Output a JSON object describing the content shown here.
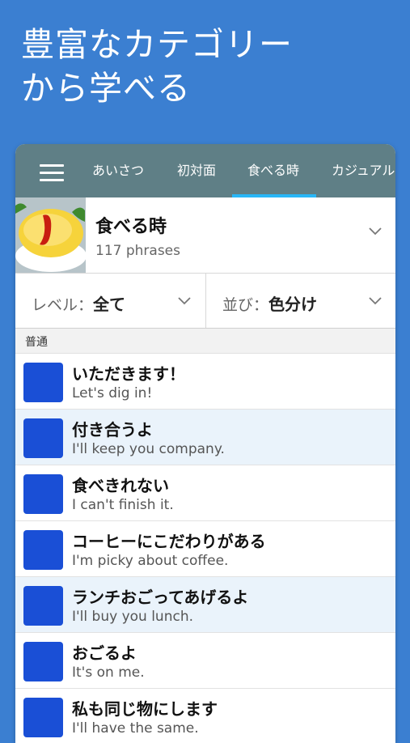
{
  "headline": {
    "line1": "豊富なカテゴリー",
    "line2": "から学べる"
  },
  "tabs": [
    "あいさつ",
    "初対面",
    "食べる時",
    "カジュアル"
  ],
  "category": {
    "title": "食べる時",
    "count": "117 phrases"
  },
  "filters": {
    "level": {
      "label": "レベル：",
      "value": "全て"
    },
    "sort": {
      "label": "並び：",
      "value": "色分け"
    }
  },
  "section": "普通",
  "phrases": [
    {
      "ja": "いただきます！",
      "en": "Let's dig in!"
    },
    {
      "ja": "付き合うよ",
      "en": "I'll keep you company."
    },
    {
      "ja": "食べきれない",
      "en": "I can't finish it."
    },
    {
      "ja": "コーヒーにこだわりがある",
      "en": "I'm picky about coffee."
    },
    {
      "ja": "ランチおごってあげるよ",
      "en": "I'll buy you lunch."
    },
    {
      "ja": "おごるよ",
      "en": "It's on me."
    },
    {
      "ja": "私も同じ物にします",
      "en": "I'll have the same."
    }
  ],
  "colors": {
    "background": "#3b7fd1",
    "tabbar": "#5f7f86",
    "indicator": "#29b6f6",
    "phrase_square": "#1a4fd6"
  }
}
